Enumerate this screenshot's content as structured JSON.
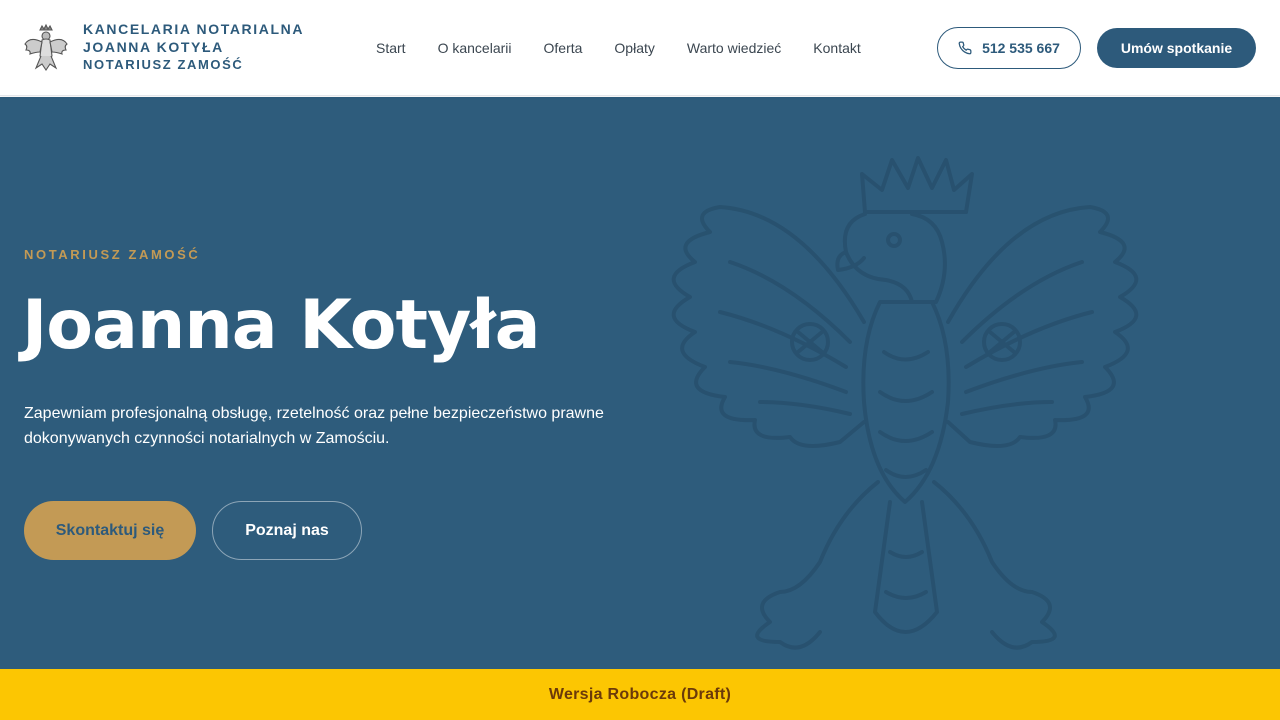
{
  "header": {
    "brand": {
      "line1": "KANCELARIA NOTARIALNA",
      "line2": "JOANNA KOTYŁA",
      "line3": "NOTARIUSZ ZAMOŚĆ"
    },
    "logo_icon": "polish-eagle-icon",
    "nav": [
      {
        "label": "Start"
      },
      {
        "label": "O kancelarii"
      },
      {
        "label": "Oferta"
      },
      {
        "label": "Opłaty"
      },
      {
        "label": "Warto wiedzieć"
      },
      {
        "label": "Kontakt"
      }
    ],
    "phone": {
      "icon": "phone-icon",
      "label": "512 535 667"
    },
    "appointment_label": "Umów spotkanie"
  },
  "hero": {
    "eyebrow": "NOTARIUSZ ZAMOŚĆ",
    "title": "Joanna Kotyła",
    "description": "Zapewniam profesjonalną obsługę, rzetelność oraz pełne bezpieczeństwo prawne dokonywanych czynności notarialnych w Zamościu.",
    "primary_cta": "Skontaktuj się",
    "secondary_cta": "Poznaj nas",
    "background_icon": "polish-eagle-icon"
  },
  "banner": {
    "label": "Wersja Robocza (Draft)"
  },
  "colors": {
    "primary": "#2d5a7b",
    "hero_bg": "#2e5c7c",
    "accent_gold": "#c39a55",
    "banner_yellow": "#fcc602",
    "banner_text": "#6b3a0a"
  }
}
